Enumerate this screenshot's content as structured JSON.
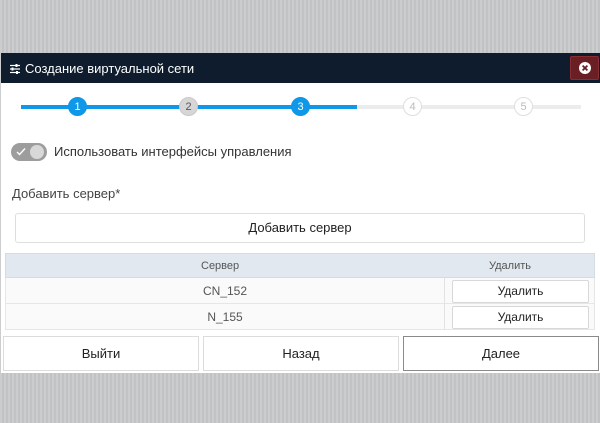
{
  "dialog": {
    "title": "Создание виртуальной сети",
    "title_icon": "sliders-icon",
    "close_icon": "close-icon"
  },
  "stepper": {
    "current_step": 3,
    "steps": [
      {
        "label": "1",
        "state": "done"
      },
      {
        "label": "2",
        "state": "skipped"
      },
      {
        "label": "3",
        "state": "active"
      },
      {
        "label": "4",
        "state": "pending"
      },
      {
        "label": "5",
        "state": "pending"
      }
    ]
  },
  "toggle": {
    "label": "Использовать интерфейсы управления",
    "checked": true
  },
  "add_server": {
    "label": "Добавить сервер*",
    "button_label": "Добавить сервер"
  },
  "table": {
    "columns": [
      "Сервер",
      "Удалить"
    ],
    "rows": [
      {
        "server": "CN_152",
        "action": "Удалить"
      },
      {
        "server": "N_155",
        "action": "Удалить"
      }
    ]
  },
  "footer": {
    "exit_label": "Выйти",
    "back_label": "Назад",
    "next_label": "Далее"
  },
  "colors": {
    "accent": "#0f97e8",
    "titlebar": "#0e1c2e",
    "close_button": "#6a1f24"
  }
}
